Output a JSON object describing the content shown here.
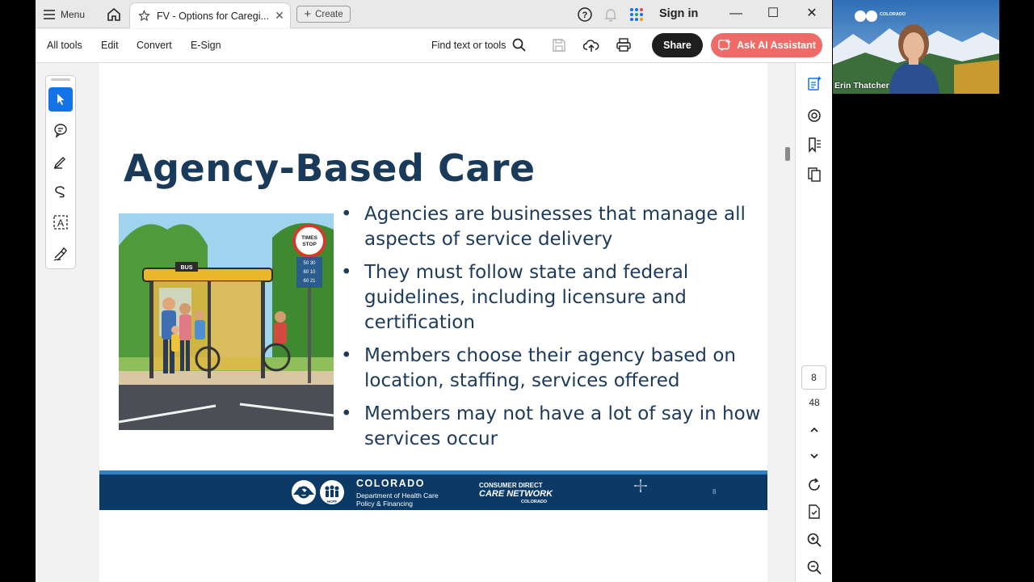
{
  "titlebar": {
    "menu_label": "Menu",
    "tab_title": "FV - Options for Caregi...",
    "create_label": "Create",
    "sign_in_label": "Sign in"
  },
  "toolbar": {
    "menus": [
      "All tools",
      "Edit",
      "Convert",
      "E-Sign"
    ],
    "find_label": "Find text or tools",
    "share_label": "Share",
    "ai_label": "Ask AI Assistant"
  },
  "slide": {
    "title": "Agency-Based Care",
    "bullets": [
      "Agencies are businesses that manage all aspects of service delivery",
      "They must follow state and federal guidelines, including licensure and certification",
      "Members choose their agency based on location, staffing, services offered",
      "Members may not have a lot of say in how services occur"
    ],
    "image_text": {
      "bus_sign": "BUS",
      "stop_sign_line1": "TIMES",
      "stop_sign_line2": "STOP",
      "schedule": [
        "50  30",
        "60  10",
        "60  21"
      ]
    },
    "footer": {
      "state": "COLORADO",
      "dept_line1": "Department of Health Care",
      "dept_line2": "Policy & Financing",
      "hcpf": "HCPF",
      "cdcn_line1": "CONSUMER DIRECT",
      "cdcn_line2": "CARE NETWORK",
      "cdcn_line3": "COLORADO",
      "slide_number": "8"
    }
  },
  "navigation": {
    "current_page": "8",
    "total_pages": "48"
  },
  "video": {
    "participant_name": "Erin Thatcher",
    "background_logo_text": "COLORADO"
  },
  "colors": {
    "accent_blue": "#1473e6",
    "ai_button": "#ef6b67",
    "slide_title": "#1a3a5a",
    "footer_band": "#0b3a67"
  }
}
